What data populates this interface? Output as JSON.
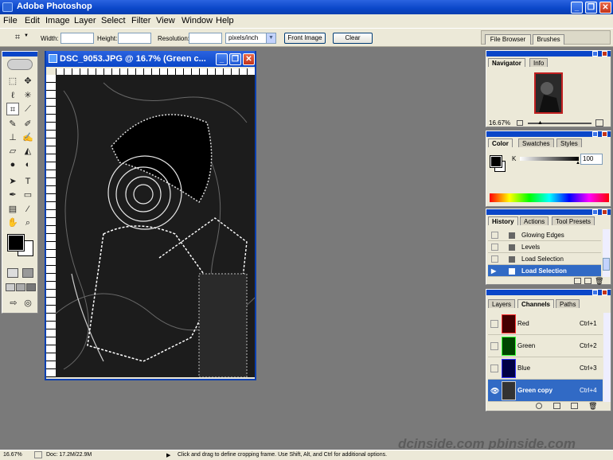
{
  "app": {
    "title": "Adobe Photoshop"
  },
  "menu": [
    "File",
    "Edit",
    "Image",
    "Layer",
    "Select",
    "Filter",
    "View",
    "Window",
    "Help"
  ],
  "options": {
    "width_label": "Width:",
    "height_label": "Height:",
    "resolution_label": "Resolution:",
    "units_value": "pixels/inch",
    "front_image": "Front Image",
    "clear": "Clear"
  },
  "palette_well": {
    "file_browser": "File Browser",
    "brushes": "Brushes"
  },
  "document": {
    "title": "DSC_9053.JPG @ 16.7% (Green c..."
  },
  "navigator": {
    "tabs": [
      "Navigator",
      "Info"
    ],
    "zoom": "16.67%"
  },
  "color": {
    "tabs": [
      "Color",
      "Swatches",
      "Styles"
    ],
    "channel": "K",
    "value": "100"
  },
  "history": {
    "tabs": [
      "History",
      "Actions",
      "Tool Presets"
    ],
    "items": [
      "Glowing Edges",
      "Levels",
      "Load Selection",
      "Load Selection"
    ]
  },
  "channels": {
    "tabs": [
      "Layers",
      "Channels",
      "Paths"
    ],
    "items": [
      {
        "name": "Red",
        "shortcut": "Ctrl+1"
      },
      {
        "name": "Green",
        "shortcut": "Ctrl+2"
      },
      {
        "name": "Blue",
        "shortcut": "Ctrl+3"
      },
      {
        "name": "Green copy",
        "shortcut": "Ctrl+4"
      }
    ]
  },
  "status": {
    "zoom": "16.67%",
    "doc": "Doc: 17.2M/22.9M",
    "hint": "Click and drag to define cropping frame. Use Shift, Alt, and Ctrl for additional options.",
    "watermark": "dcinside.com  pbinside.com"
  },
  "colors": {
    "title_blue": "#0a46c8",
    "selection_blue": "#316ac5",
    "chrome": "#ece9d8"
  }
}
